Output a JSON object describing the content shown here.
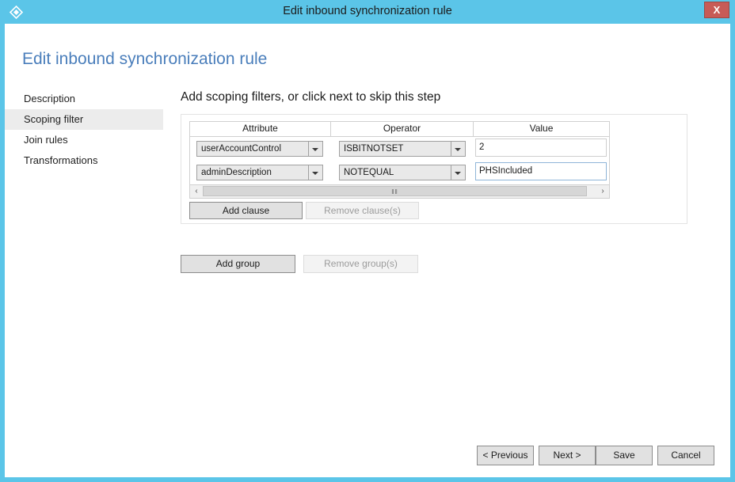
{
  "window": {
    "title": "Edit inbound synchronization rule",
    "app_icon": "diamond-icon",
    "close_label": "X",
    "border_color": "#5bc5e8",
    "close_color": "#c75b57"
  },
  "page": {
    "title": "Edit inbound synchronization rule",
    "title_color": "#4a7ebb"
  },
  "sidebar": {
    "items": [
      {
        "label": "Description",
        "selected": false
      },
      {
        "label": "Scoping filter",
        "selected": true
      },
      {
        "label": "Join rules",
        "selected": false
      },
      {
        "label": "Transformations",
        "selected": false
      }
    ]
  },
  "content": {
    "heading": "Add scoping filters, or click next to skip this step",
    "grid": {
      "columns": [
        "Attribute",
        "Operator",
        "Value"
      ],
      "rows": [
        {
          "attribute": "userAccountControl",
          "operator": "ISBITNOTSET",
          "value": "2",
          "value_focused": false
        },
        {
          "attribute": "adminDescription",
          "operator": "NOTEQUAL",
          "value": "PHSIncluded",
          "value_focused": true
        }
      ],
      "scrollbar": {
        "left_arrow": "‹",
        "right_arrow": "›",
        "grip": "‖‖"
      }
    },
    "clause_buttons": {
      "add": "Add clause",
      "remove": "Remove clause(s)",
      "remove_disabled": true
    },
    "group_buttons": {
      "add": "Add group",
      "remove": "Remove group(s)",
      "remove_disabled": true
    }
  },
  "footer": {
    "previous": "< Previous",
    "next": "Next >",
    "save": "Save",
    "cancel": "Cancel"
  }
}
